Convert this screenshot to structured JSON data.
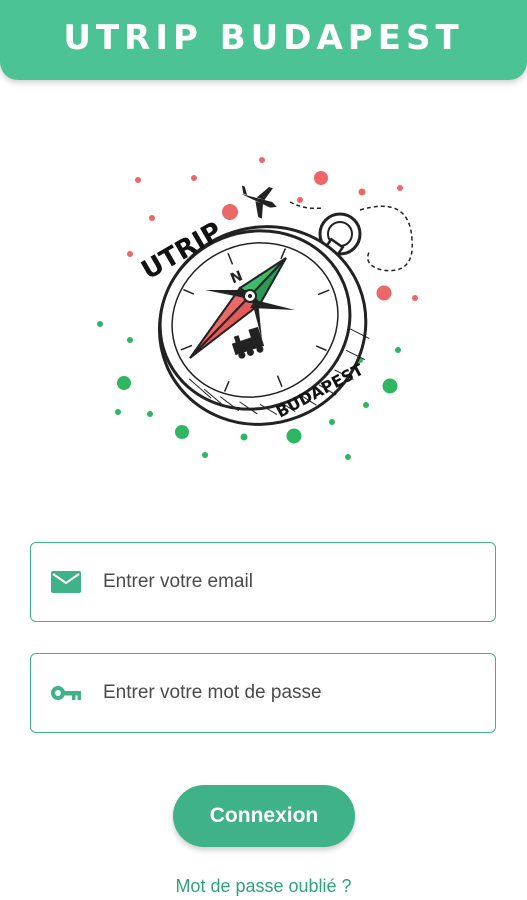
{
  "header": {
    "title": "UTRIP BUDAPEST"
  },
  "logo": {
    "name": "utrip-budapest-compass-logo",
    "top_text": "UTRIP",
    "bottom_text": "BUDAPEST"
  },
  "email": {
    "placeholder": "Entrer votre email",
    "icon": "mail-icon"
  },
  "password": {
    "placeholder": "Entrer votre mot de passe",
    "icon": "key-icon"
  },
  "login": {
    "label": "Connexion"
  },
  "forgot": {
    "label": "Mot de passe oublié ?"
  },
  "colors": {
    "accent": "#3fb288",
    "header": "#4cc394",
    "red": "#ec5a5a",
    "green": "#2fb661"
  }
}
